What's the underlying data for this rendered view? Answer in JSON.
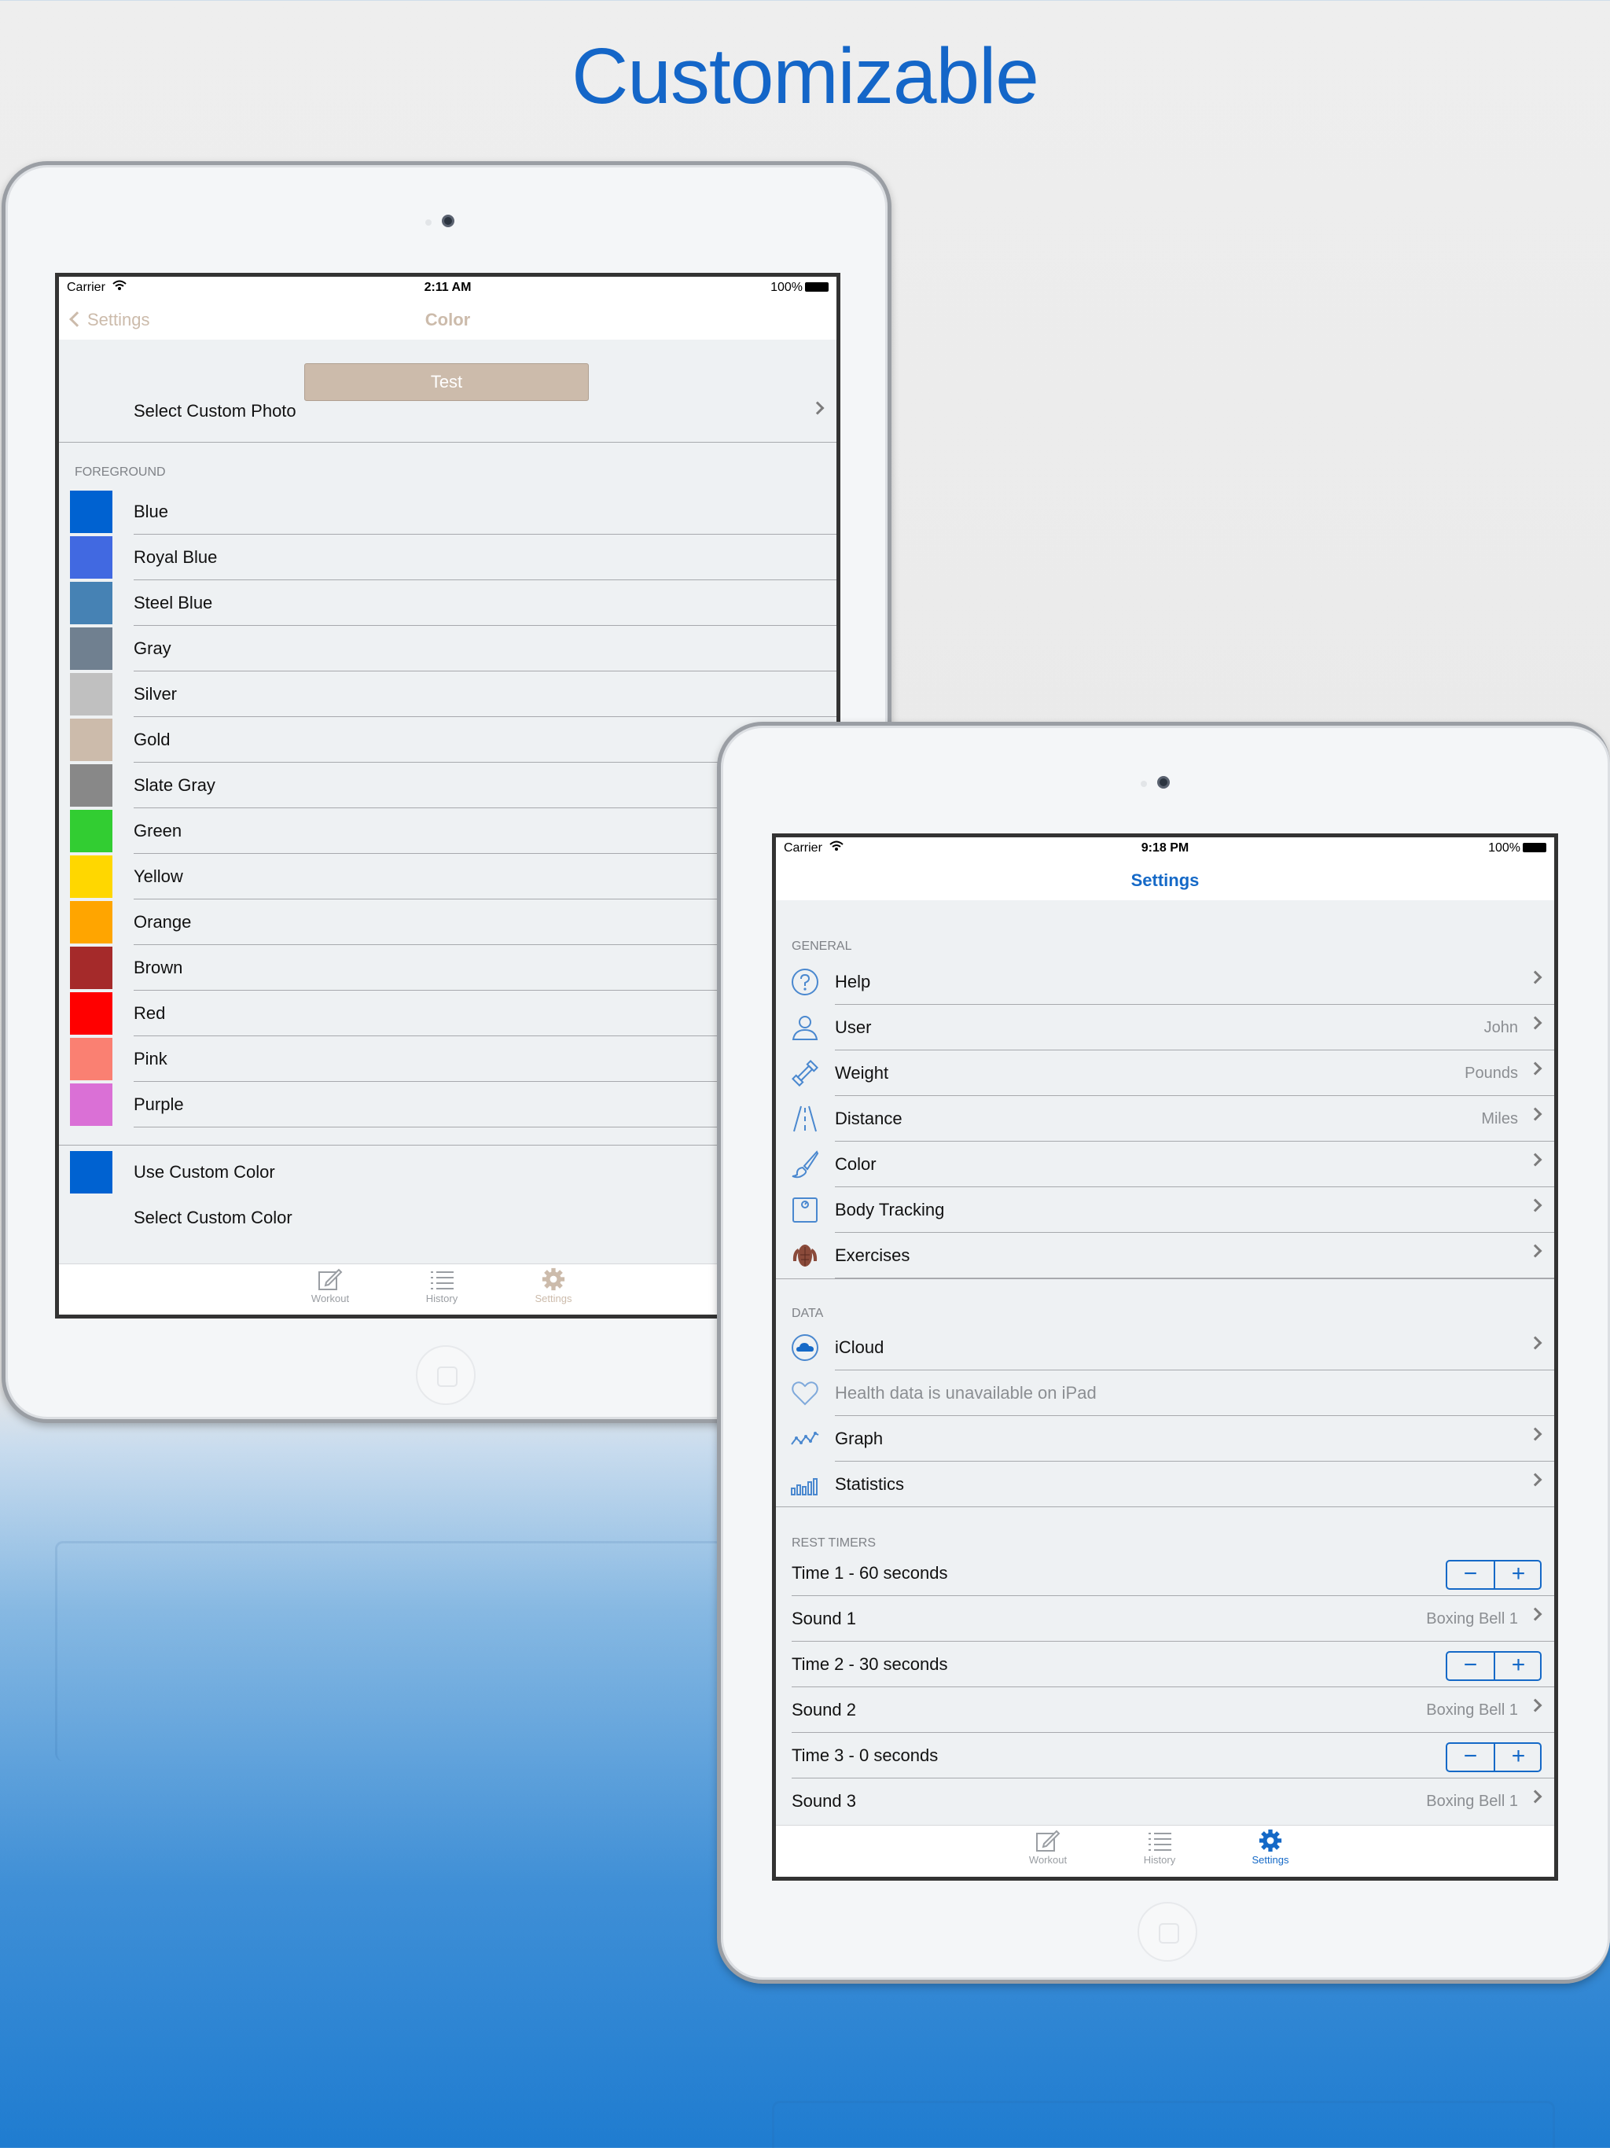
{
  "headline": "Customizable",
  "colors": {
    "accent": "#1569c7",
    "gold_tint": "#ccbbab"
  },
  "color_screen": {
    "status": {
      "carrier": "Carrier",
      "time": "2:11 AM",
      "battery": "100%"
    },
    "nav": {
      "back_label": "Settings",
      "title": "Color"
    },
    "test_button": "Test",
    "select_custom_photo": "Select Custom Photo",
    "section_foreground": "FOREGROUND",
    "colors": [
      {
        "name": "Blue",
        "hex": "#0062d1"
      },
      {
        "name": "Royal Blue",
        "hex": "#4169e1"
      },
      {
        "name": "Steel Blue",
        "hex": "#4682b4"
      },
      {
        "name": "Gray",
        "hex": "#708090"
      },
      {
        "name": "Silver",
        "hex": "#c0c0c0"
      },
      {
        "name": "Gold",
        "hex": "#ccbbab"
      },
      {
        "name": "Slate Gray",
        "hex": "#888888"
      },
      {
        "name": "Green",
        "hex": "#32cd32"
      },
      {
        "name": "Yellow",
        "hex": "#ffd700"
      },
      {
        "name": "Orange",
        "hex": "#ffa500"
      },
      {
        "name": "Brown",
        "hex": "#a52a2a"
      },
      {
        "name": "Red",
        "hex": "#ff0000"
      },
      {
        "name": "Pink",
        "hex": "#fa8072"
      },
      {
        "name": "Purple",
        "hex": "#da70d6"
      }
    ],
    "use_custom_color": "Use Custom Color",
    "use_custom_color_hex": "#0062d1",
    "select_custom_color": "Select Custom Color",
    "tabs": {
      "workout": "Workout",
      "history": "History",
      "settings": "Settings"
    }
  },
  "settings_screen": {
    "status": {
      "carrier": "Carrier",
      "time": "9:18 PM",
      "battery": "100%"
    },
    "nav": {
      "title": "Settings"
    },
    "general_header": "GENERAL",
    "general": [
      {
        "label": "Help",
        "detail": "",
        "icon": "help-icon"
      },
      {
        "label": "User",
        "detail": "John",
        "icon": "user-icon"
      },
      {
        "label": "Weight",
        "detail": "Pounds",
        "icon": "dumbbell-icon"
      },
      {
        "label": "Distance",
        "detail": "Miles",
        "icon": "road-icon"
      },
      {
        "label": "Color",
        "detail": "",
        "icon": "brush-icon"
      },
      {
        "label": "Body Tracking",
        "detail": "",
        "icon": "scale-icon"
      },
      {
        "label": "Exercises",
        "detail": "",
        "icon": "muscle-icon"
      }
    ],
    "data_header": "DATA",
    "data": [
      {
        "label": "iCloud",
        "icon": "cloud-icon"
      },
      {
        "label": "Health data is unavailable on iPad",
        "icon": "heart-icon"
      },
      {
        "label": "Graph",
        "icon": "graph-icon"
      },
      {
        "label": "Statistics",
        "icon": "statistics-icon"
      }
    ],
    "rest_header": "REST TIMERS",
    "rest": {
      "time1": "Time 1 - 60 seconds",
      "sound1": "Sound 1",
      "sound1_value": "Boxing Bell 1",
      "time2": "Time 2 - 30 seconds",
      "sound2": "Sound 2",
      "sound2_value": "Boxing Bell 1",
      "time3": "Time 3 - 0 seconds",
      "sound3": "Sound 3",
      "sound3_value": "Boxing Bell 1",
      "minus": "−",
      "plus": "+"
    },
    "tabs": {
      "workout": "Workout",
      "history": "History",
      "settings": "Settings"
    }
  }
}
